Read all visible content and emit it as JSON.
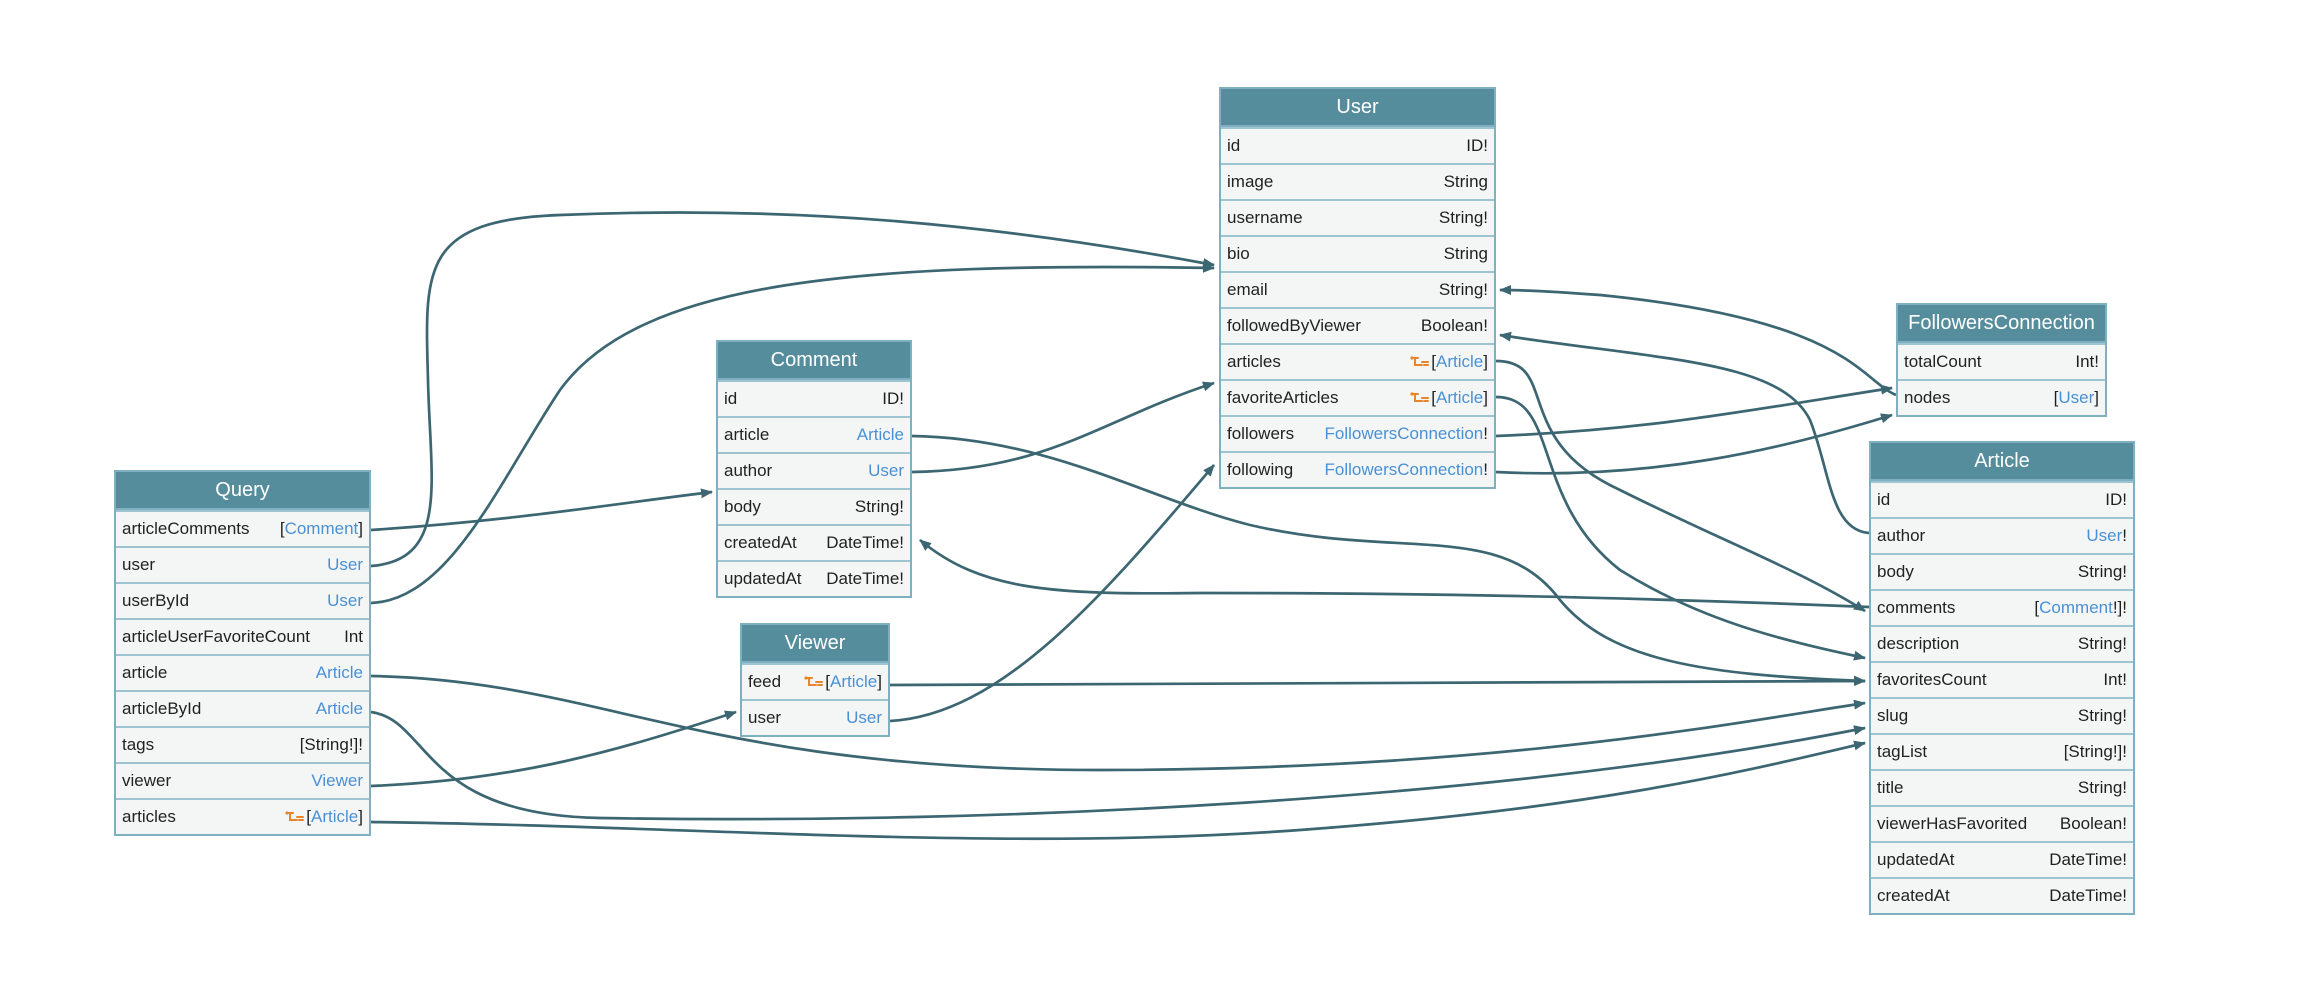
{
  "colors": {
    "header": "#568d9c",
    "border": "#7fb0c2",
    "row_bg": "#f4f6f6",
    "link_type": "#4a90d4",
    "edge": "#3c6672",
    "connection_icon": "#e8852a"
  },
  "nodes": [
    {
      "id": "Query",
      "title": "Query",
      "fields": [
        {
          "name": "articleComments",
          "prefix": "[",
          "type": "Comment",
          "suffix": "]",
          "link": true
        },
        {
          "name": "user",
          "prefix": "",
          "type": "User",
          "suffix": "",
          "link": true
        },
        {
          "name": "userById",
          "prefix": "",
          "type": "User",
          "suffix": "",
          "link": true
        },
        {
          "name": "articleUserFavoriteCount",
          "prefix": "",
          "type": "Int",
          "suffix": "",
          "link": false
        },
        {
          "name": "article",
          "prefix": "",
          "type": "Article",
          "suffix": "",
          "link": true
        },
        {
          "name": "articleById",
          "prefix": "",
          "type": "Article",
          "suffix": "",
          "link": true
        },
        {
          "name": "tags",
          "prefix": "",
          "type": "[String!]!",
          "suffix": "",
          "link": false
        },
        {
          "name": "viewer",
          "prefix": "",
          "type": "Viewer",
          "suffix": "",
          "link": true
        },
        {
          "name": "articles",
          "prefix": "[",
          "type": "Article",
          "suffix": "]",
          "link": true,
          "connection_icon": "connection-icon"
        }
      ]
    },
    {
      "id": "Comment",
      "title": "Comment",
      "fields": [
        {
          "name": "id",
          "prefix": "",
          "type": "ID!",
          "suffix": "",
          "link": false
        },
        {
          "name": "article",
          "prefix": "",
          "type": "Article",
          "suffix": "",
          "link": true
        },
        {
          "name": "author",
          "prefix": "",
          "type": "User",
          "suffix": "",
          "link": true
        },
        {
          "name": "body",
          "prefix": "",
          "type": "String!",
          "suffix": "",
          "link": false
        },
        {
          "name": "createdAt",
          "prefix": "",
          "type": "DateTime!",
          "suffix": "",
          "link": false
        },
        {
          "name": "updatedAt",
          "prefix": "",
          "type": "DateTime!",
          "suffix": "",
          "link": false
        }
      ]
    },
    {
      "id": "Viewer",
      "title": "Viewer",
      "fields": [
        {
          "name": "feed",
          "prefix": "[",
          "type": "Article",
          "suffix": "]",
          "link": true,
          "connection_icon": "connection-icon"
        },
        {
          "name": "user",
          "prefix": "",
          "type": "User",
          "suffix": "",
          "link": true
        }
      ]
    },
    {
      "id": "User",
      "title": "User",
      "fields": [
        {
          "name": "id",
          "prefix": "",
          "type": "ID!",
          "suffix": "",
          "link": false
        },
        {
          "name": "image",
          "prefix": "",
          "type": "String",
          "suffix": "",
          "link": false
        },
        {
          "name": "username",
          "prefix": "",
          "type": "String!",
          "suffix": "",
          "link": false
        },
        {
          "name": "bio",
          "prefix": "",
          "type": "String",
          "suffix": "",
          "link": false
        },
        {
          "name": "email",
          "prefix": "",
          "type": "String!",
          "suffix": "",
          "link": false
        },
        {
          "name": "followedByViewer",
          "prefix": "",
          "type": "Boolean!",
          "suffix": "",
          "link": false
        },
        {
          "name": "articles",
          "prefix": "[",
          "type": "Article",
          "suffix": "]",
          "link": true,
          "connection_icon": "connection-icon"
        },
        {
          "name": "favoriteArticles",
          "prefix": "[",
          "type": "Article",
          "suffix": "]",
          "link": true,
          "connection_icon": "connection-icon"
        },
        {
          "name": "followers",
          "prefix": "",
          "type": "FollowersConnection",
          "suffix": "!",
          "link": true
        },
        {
          "name": "following",
          "prefix": "",
          "type": "FollowersConnection",
          "suffix": "!",
          "link": true
        }
      ]
    },
    {
      "id": "FollowersConnection",
      "title": "FollowersConnection",
      "fields": [
        {
          "name": "totalCount",
          "prefix": "",
          "type": "Int!",
          "suffix": "",
          "link": false
        },
        {
          "name": "nodes",
          "prefix": "[",
          "type": "User",
          "suffix": "]",
          "link": true
        }
      ]
    },
    {
      "id": "Article",
      "title": "Article",
      "fields": [
        {
          "name": "id",
          "prefix": "",
          "type": "ID!",
          "suffix": "",
          "link": false
        },
        {
          "name": "author",
          "prefix": "",
          "type": "User",
          "suffix": "!",
          "link": true
        },
        {
          "name": "body",
          "prefix": "",
          "type": "String!",
          "suffix": "",
          "link": false
        },
        {
          "name": "comments",
          "prefix": "[",
          "type": "Comment",
          "suffix": "!]!",
          "link": true
        },
        {
          "name": "description",
          "prefix": "",
          "type": "String!",
          "suffix": "",
          "link": false
        },
        {
          "name": "favoritesCount",
          "prefix": "",
          "type": "Int!",
          "suffix": "",
          "link": false
        },
        {
          "name": "slug",
          "prefix": "",
          "type": "String!",
          "suffix": "",
          "link": false
        },
        {
          "name": "tagList",
          "prefix": "",
          "type": "[String!]!",
          "suffix": "",
          "link": false
        },
        {
          "name": "title",
          "prefix": "",
          "type": "String!",
          "suffix": "",
          "link": false
        },
        {
          "name": "viewerHasFavorited",
          "prefix": "",
          "type": "Boolean!",
          "suffix": "",
          "link": false
        },
        {
          "name": "updatedAt",
          "prefix": "",
          "type": "DateTime!",
          "suffix": "",
          "link": false
        },
        {
          "name": "createdAt",
          "prefix": "",
          "type": "DateTime!",
          "suffix": "",
          "link": false
        }
      ]
    }
  ],
  "edges": [
    {
      "from": "Query.articleComments",
      "to": "Comment"
    },
    {
      "from": "Query.user",
      "to": "User"
    },
    {
      "from": "Query.userById",
      "to": "User"
    },
    {
      "from": "Query.article",
      "to": "Article"
    },
    {
      "from": "Query.articleById",
      "to": "Article"
    },
    {
      "from": "Query.viewer",
      "to": "Viewer"
    },
    {
      "from": "Query.articles",
      "to": "Article"
    },
    {
      "from": "Comment.article",
      "to": "Article"
    },
    {
      "from": "Comment.author",
      "to": "User"
    },
    {
      "from": "Viewer.feed",
      "to": "Article"
    },
    {
      "from": "Viewer.user",
      "to": "User"
    },
    {
      "from": "User.articles",
      "to": "Article"
    },
    {
      "from": "User.favoriteArticles",
      "to": "Article"
    },
    {
      "from": "User.followers",
      "to": "FollowersConnection"
    },
    {
      "from": "User.following",
      "to": "FollowersConnection"
    },
    {
      "from": "FollowersConnection.nodes",
      "to": "User"
    },
    {
      "from": "Article.author",
      "to": "User"
    },
    {
      "from": "Article.comments",
      "to": "Comment"
    }
  ]
}
